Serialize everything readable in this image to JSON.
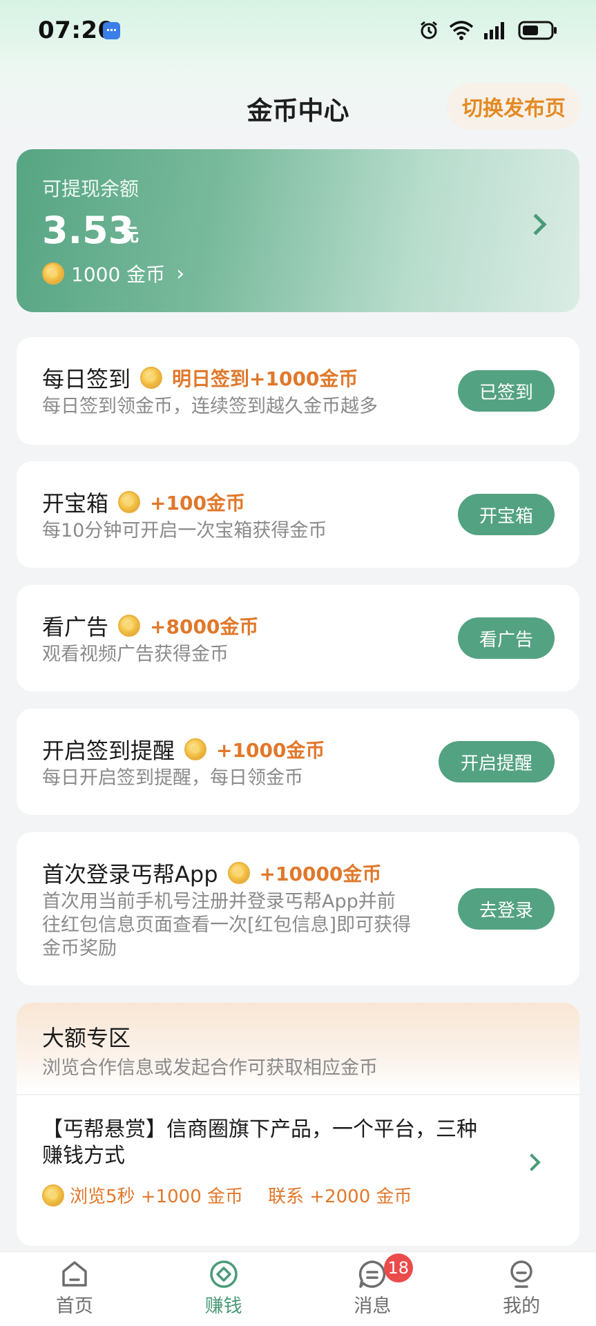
{
  "status_bar": {
    "time": "07:20"
  },
  "header": {
    "title": "金币中心",
    "switch_label": "切换发布页"
  },
  "balance": {
    "label": "可提现余额",
    "amount": "3.53",
    "unit": "元",
    "coins_text": "1000 金币"
  },
  "tasks": [
    {
      "title": "每日签到",
      "reward": "明日签到+1000金币",
      "desc": "每日签到领金币，连续签到越久金币越多",
      "button": "已签到"
    },
    {
      "title": "开宝箱",
      "reward": "+100金币",
      "desc": "每10分钟可开启一次宝箱获得金币",
      "button": "开宝箱"
    },
    {
      "title": "看广告",
      "reward": "+8000金币",
      "desc": "观看视频广告获得金币",
      "button": "看广告"
    },
    {
      "title": "开启签到提醒",
      "reward": "+1000金币",
      "desc": "每日开启签到提醒，每日领金币",
      "button": "开启提醒"
    },
    {
      "title": "首次登录丐帮App",
      "reward": "+10000金币",
      "desc_lines": [
        "首次用当前手机号注册并登录丐帮App并前",
        "往红包信息页面查看一次[红包信息]即可获得",
        "金币奖励"
      ],
      "button": "去登录"
    }
  ],
  "big_zone": {
    "title": "大额专区",
    "subtitle": "浏览合作信息或发起合作可获取相应金币",
    "item_title_lines": [
      "【丐帮悬赏】信商圈旗下产品，一个平台，三种",
      "赚钱方式"
    ],
    "browse_reward": "浏览5秒 +1000 金币",
    "contact_reward": "联系 +2000 金币"
  },
  "nav": [
    {
      "label": "首页",
      "icon": "home-icon"
    },
    {
      "label": "赚钱",
      "icon": "earn-icon"
    },
    {
      "label": "消息",
      "icon": "message-icon",
      "badge": "18"
    },
    {
      "label": "我的",
      "icon": "profile-icon"
    }
  ],
  "colors": {
    "accent_green": "#53a281",
    "reward_orange": "#e0782b",
    "badge_red": "#ec4b4b"
  }
}
